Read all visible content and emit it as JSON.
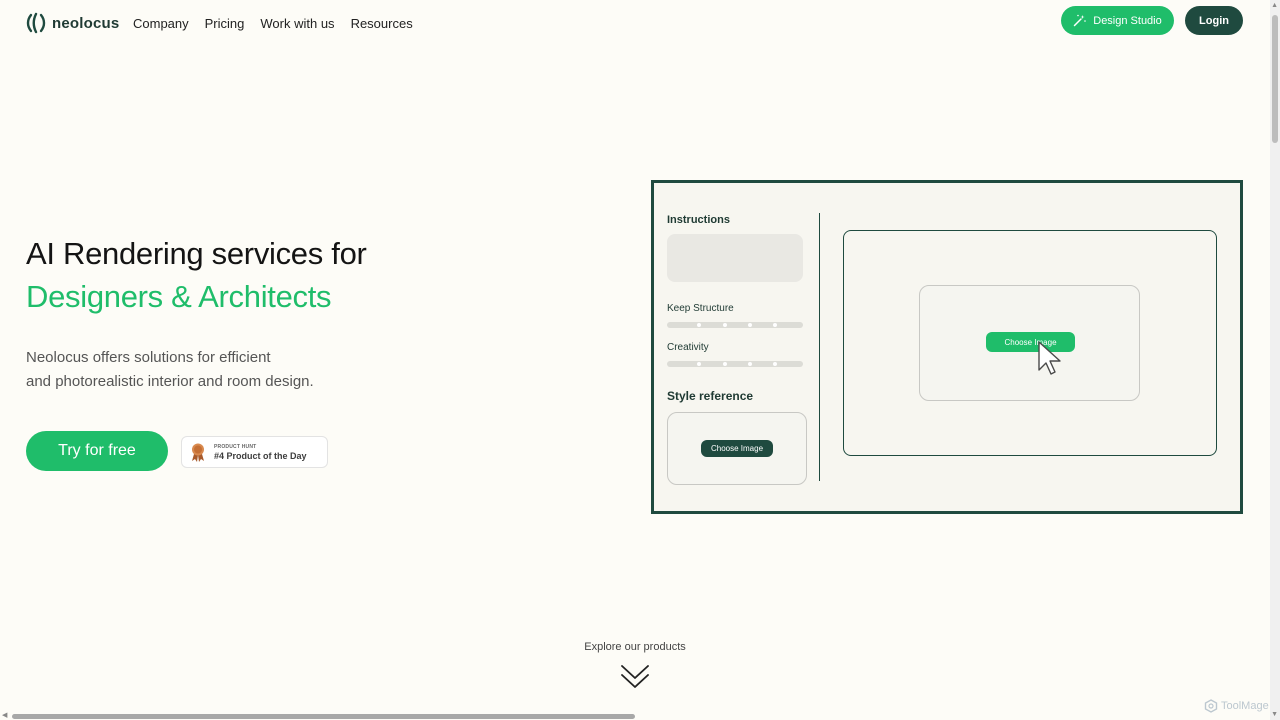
{
  "header": {
    "logo_text": "neolocus",
    "nav": [
      "Company",
      "Pricing",
      "Work with us",
      "Resources"
    ],
    "design_studio_label": "Design Studio",
    "login_label": "Login"
  },
  "hero": {
    "title_line1": "AI Rendering services for",
    "title_line2": "Designers & Architects",
    "desc_line1": "Neolocus offers solutions for efficient",
    "desc_line2": "and photorealistic interior and room design.",
    "cta_label": "Try for free",
    "badge_small": "PRODUCT HUNT",
    "badge_big": "#4 Product of the Day"
  },
  "mockup": {
    "instructions_label": "Instructions",
    "keep_structure_label": "Keep Structure",
    "creativity_label": "Creativity",
    "style_reference_label": "Style reference",
    "style_choose_label": "Choose Image",
    "main_choose_label": "Choose Image"
  },
  "explore_label": "Explore our products",
  "watermark_text": "ToolMage",
  "colors": {
    "accent_green": "#1fbd6a",
    "dark_green": "#1f4a3f",
    "background": "#fdfcf7"
  }
}
